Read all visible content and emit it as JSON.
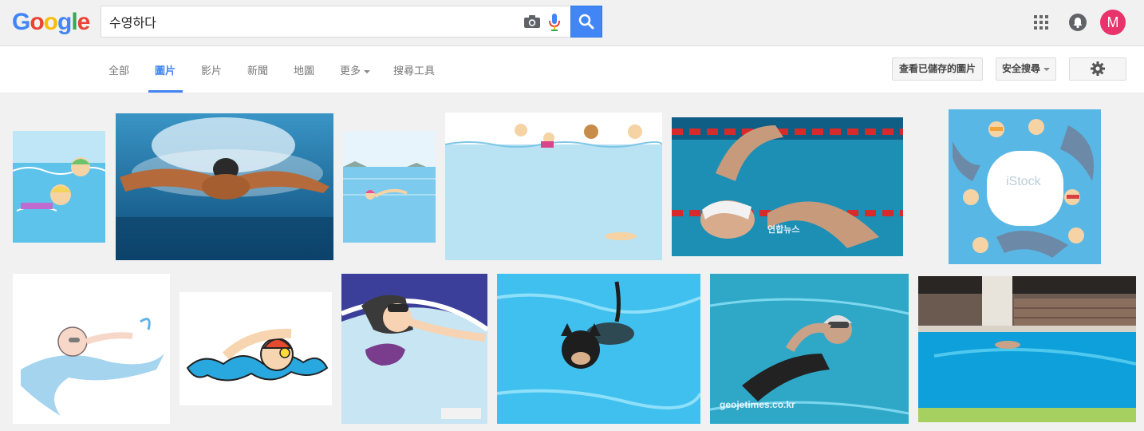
{
  "header": {
    "logo": [
      "G",
      "o",
      "o",
      "g",
      "l",
      "e"
    ],
    "logo_colors": [
      "#4285f4",
      "#ea4335",
      "#fbbc05",
      "#4285f4",
      "#34a853",
      "#ea4335"
    ],
    "search_query": "수영하다",
    "avatar_letter": "M"
  },
  "nav": {
    "tabs": [
      "全部",
      "圖片",
      "影片",
      "新聞",
      "地圖",
      "更多",
      "搜尋工具"
    ],
    "active_tab": "圖片",
    "saved_images_label": "查看已儲存的圖片",
    "safe_search_label": "安全搜尋"
  },
  "results": {
    "watermarks": [
      "연합뉴스",
      "iStock",
      "geojetimes.co.kr"
    ]
  },
  "colors": {
    "accent": "#4285f4",
    "avatar": "#e8336b"
  }
}
